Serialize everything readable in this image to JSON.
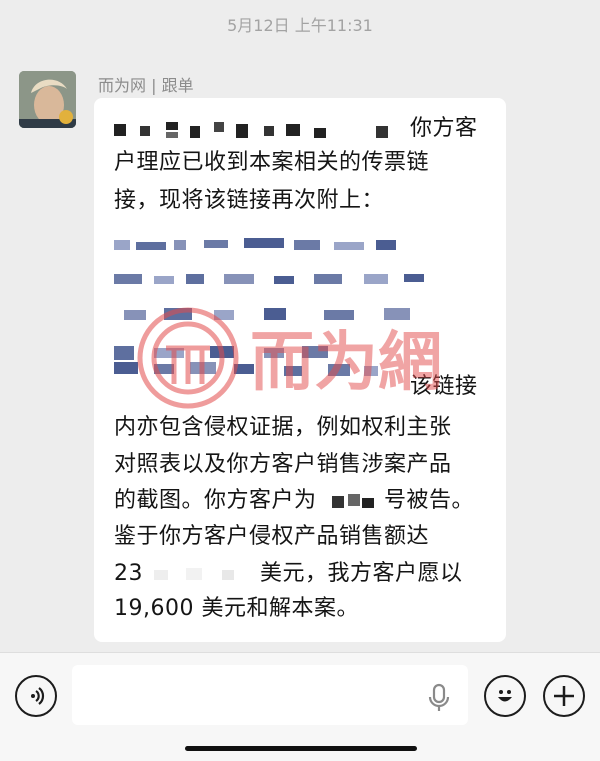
{
  "timestamp": "5月12日 上午11:31",
  "sender": {
    "name": "而为网 | 跟单"
  },
  "message": {
    "lines": [
      "你方客",
      "户理应已收到本案相关的传票链",
      "接，现将该链接再次附上：",
      "该链接",
      "内亦包含侵权证据，例如权利主张",
      "对照表以及你方客户销售涉案产品",
      "的截图。你方客户为",
      "号被告。",
      "鉴于你方客户侵权产品销售额达",
      "23",
      "美元，我方客户愿以",
      "19,600 美元和解本案。"
    ]
  },
  "watermark": {
    "brand": "而为網"
  },
  "icons": {
    "avatar": "avatar-image",
    "voice": "voice-icon",
    "mic": "microphone-icon",
    "emoji": "emoji-icon",
    "plus": "plus-icon"
  },
  "colors": {
    "background": "#ededed",
    "bubble": "#ffffff",
    "watermark": "#e24a4a"
  }
}
